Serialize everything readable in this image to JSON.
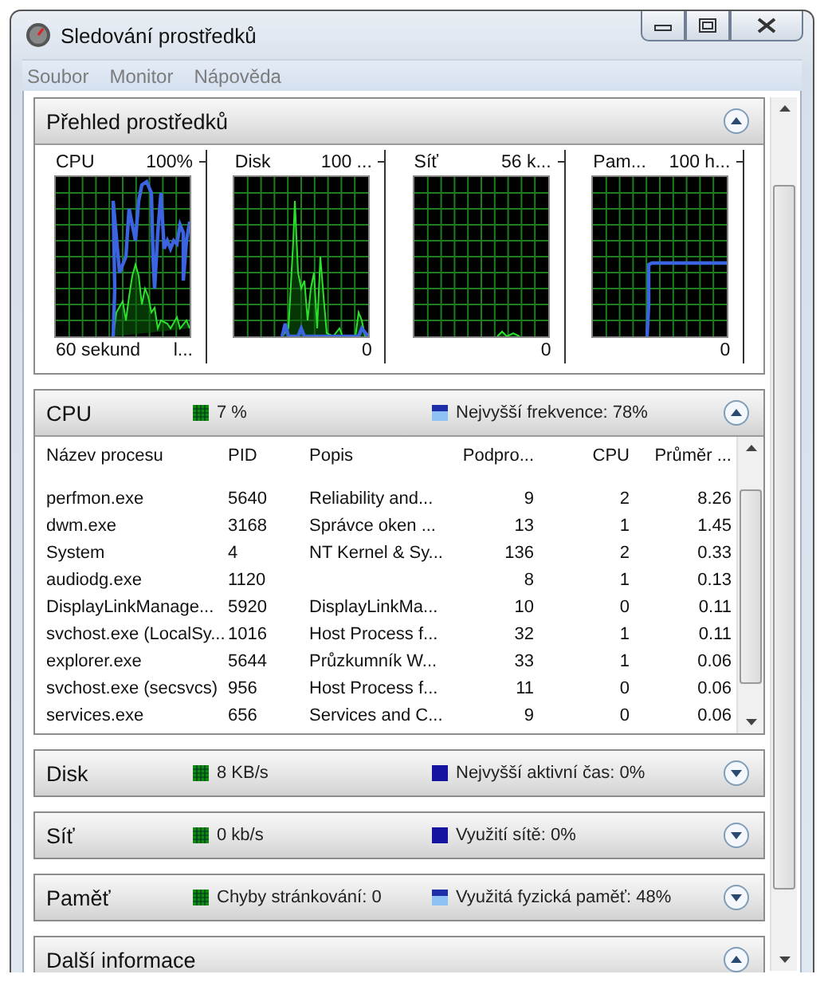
{
  "window": {
    "title": "Sledování prostředků"
  },
  "menu": [
    "Soubor",
    "Monitor",
    "Nápověda"
  ],
  "overview": {
    "title": "Přehled prostředků",
    "expanded": true,
    "graphs": [
      {
        "title": "CPU",
        "top_value": "100%",
        "bottom_left": "60 sekund",
        "bottom_value": "l..."
      },
      {
        "title": "Disk",
        "top_value": "100 ...",
        "bottom_value": "0"
      },
      {
        "title": "Síť",
        "top_value": "56 k...",
        "bottom_value": "0"
      },
      {
        "title": "Pam...",
        "top_value": "100 h...",
        "bottom_value": "0"
      }
    ]
  },
  "sections": [
    {
      "title": "CPU",
      "expanded": true,
      "legend": [
        {
          "text": "7 %",
          "kind": "grid",
          "color": "#108a10"
        },
        {
          "text": "Nejvyšší frekvence: 78%",
          "kind": "split",
          "color": "#1c2fa8"
        }
      ],
      "table": {
        "columns": [
          "Název procesu",
          "PID",
          "Popis",
          "Podpro...",
          "CPU",
          "Průměr ..."
        ],
        "rows": [
          [
            "perfmon.exe",
            "5640",
            "Reliability and...",
            "9",
            "2",
            "8.26"
          ],
          [
            "dwm.exe",
            "3168",
            "Správce oken ...",
            "13",
            "1",
            "1.45"
          ],
          [
            "System",
            "4",
            "NT Kernel & Sy...",
            "136",
            "2",
            "0.33"
          ],
          [
            "audiodg.exe",
            "1120",
            "",
            "8",
            "1",
            "0.13"
          ],
          [
            "DisplayLinkManage...",
            "5920",
            "DisplayLinkMa...",
            "10",
            "0",
            "0.11"
          ],
          [
            "svchost.exe (LocalSy...",
            "1016",
            "Host Process f...",
            "32",
            "1",
            "0.11"
          ],
          [
            "explorer.exe",
            "5644",
            "Průzkumník W...",
            "33",
            "1",
            "0.06"
          ],
          [
            "svchost.exe (secsvcs)",
            "956",
            "Host Process f...",
            "11",
            "0",
            "0.06"
          ],
          [
            "services.exe",
            "656",
            "Services and C...",
            "9",
            "0",
            "0.06"
          ]
        ]
      }
    },
    {
      "title": "Disk",
      "expanded": false,
      "legend": [
        {
          "text": "8 KB/s",
          "kind": "grid",
          "color": "#108a10"
        },
        {
          "text": "Nejvyšší aktivní čas: 0%",
          "kind": "solid",
          "color": "#1414a0"
        }
      ]
    },
    {
      "title": "Síť",
      "expanded": false,
      "legend": [
        {
          "text": "0 kb/s",
          "kind": "grid",
          "color": "#108a10"
        },
        {
          "text": "Využití sítě: 0%",
          "kind": "solid",
          "color": "#1414a0"
        }
      ]
    },
    {
      "title": "Paměť",
      "expanded": false,
      "legend": [
        {
          "text": "Chyby stránkování: 0",
          "kind": "grid",
          "color": "#108a10"
        },
        {
          "text": "Využitá fyzická paměť: 48%",
          "kind": "split",
          "color": "#1c2fa8"
        }
      ]
    },
    {
      "title": "Další informace",
      "expanded": true
    }
  ]
}
